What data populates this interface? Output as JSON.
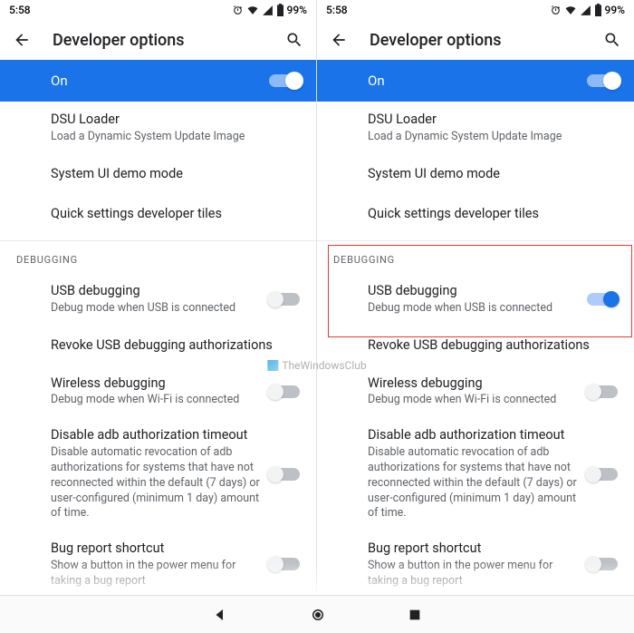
{
  "status": {
    "time": "5:58",
    "battery": "99%"
  },
  "appbar": {
    "title": "Developer options"
  },
  "master": {
    "label": "On"
  },
  "items": {
    "dsu": {
      "label": "DSU Loader",
      "desc": "Load a Dynamic System Update Image"
    },
    "sysui": {
      "label": "System UI demo mode"
    },
    "qstiles": {
      "label": "Quick settings developer tiles"
    }
  },
  "section": {
    "debugging": "DEBUGGING"
  },
  "debug": {
    "usb": {
      "label": "USB debugging",
      "desc": "Debug mode when USB is connected"
    },
    "revoke": {
      "label": "Revoke USB debugging authorizations"
    },
    "wireless": {
      "label": "Wireless debugging",
      "desc": "Debug mode when Wi-Fi is connected"
    },
    "adbto": {
      "label": "Disable adb authorization timeout",
      "desc": "Disable automatic revocation of adb authorizations for systems that have not reconnected within the default (7 days) or user-configured (minimum 1 day) amount of time."
    },
    "bugrep": {
      "label": "Bug report shortcut",
      "desc": "Show a button in the power menu for taking a bug report"
    }
  },
  "watermark": "TheWindowsClub"
}
